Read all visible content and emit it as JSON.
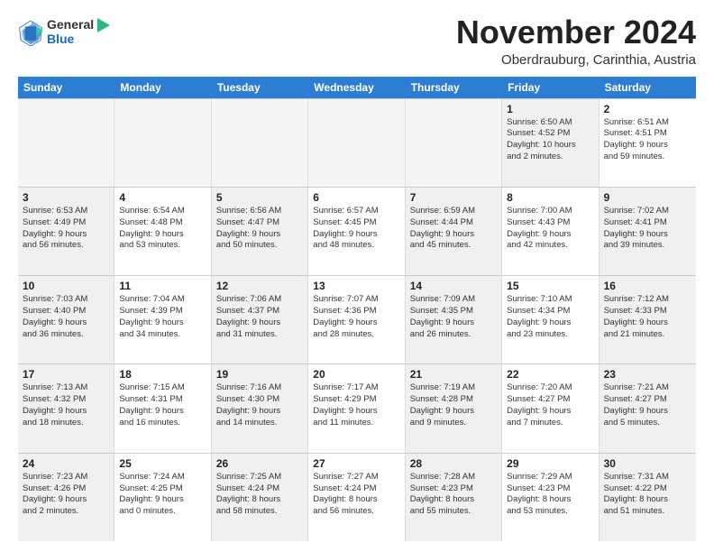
{
  "logo": {
    "general": "General",
    "blue": "Blue"
  },
  "header": {
    "month": "November 2024",
    "location": "Oberdrauburg, Carinthia, Austria"
  },
  "weekdays": [
    "Sunday",
    "Monday",
    "Tuesday",
    "Wednesday",
    "Thursday",
    "Friday",
    "Saturday"
  ],
  "weeks": [
    [
      {
        "day": "",
        "text": "",
        "empty": true
      },
      {
        "day": "",
        "text": "",
        "empty": true
      },
      {
        "day": "",
        "text": "",
        "empty": true
      },
      {
        "day": "",
        "text": "",
        "empty": true
      },
      {
        "day": "",
        "text": "",
        "empty": true
      },
      {
        "day": "1",
        "text": "Sunrise: 6:50 AM\nSunset: 4:52 PM\nDaylight: 10 hours\nand 2 minutes.",
        "shaded": true
      },
      {
        "day": "2",
        "text": "Sunrise: 6:51 AM\nSunset: 4:51 PM\nDaylight: 9 hours\nand 59 minutes.",
        "shaded": false
      }
    ],
    [
      {
        "day": "3",
        "text": "Sunrise: 6:53 AM\nSunset: 4:49 PM\nDaylight: 9 hours\nand 56 minutes.",
        "shaded": true
      },
      {
        "day": "4",
        "text": "Sunrise: 6:54 AM\nSunset: 4:48 PM\nDaylight: 9 hours\nand 53 minutes.",
        "shaded": false
      },
      {
        "day": "5",
        "text": "Sunrise: 6:56 AM\nSunset: 4:47 PM\nDaylight: 9 hours\nand 50 minutes.",
        "shaded": true
      },
      {
        "day": "6",
        "text": "Sunrise: 6:57 AM\nSunset: 4:45 PM\nDaylight: 9 hours\nand 48 minutes.",
        "shaded": false
      },
      {
        "day": "7",
        "text": "Sunrise: 6:59 AM\nSunset: 4:44 PM\nDaylight: 9 hours\nand 45 minutes.",
        "shaded": true
      },
      {
        "day": "8",
        "text": "Sunrise: 7:00 AM\nSunset: 4:43 PM\nDaylight: 9 hours\nand 42 minutes.",
        "shaded": false
      },
      {
        "day": "9",
        "text": "Sunrise: 7:02 AM\nSunset: 4:41 PM\nDaylight: 9 hours\nand 39 minutes.",
        "shaded": true
      }
    ],
    [
      {
        "day": "10",
        "text": "Sunrise: 7:03 AM\nSunset: 4:40 PM\nDaylight: 9 hours\nand 36 minutes.",
        "shaded": true
      },
      {
        "day": "11",
        "text": "Sunrise: 7:04 AM\nSunset: 4:39 PM\nDaylight: 9 hours\nand 34 minutes.",
        "shaded": false
      },
      {
        "day": "12",
        "text": "Sunrise: 7:06 AM\nSunset: 4:37 PM\nDaylight: 9 hours\nand 31 minutes.",
        "shaded": true
      },
      {
        "day": "13",
        "text": "Sunrise: 7:07 AM\nSunset: 4:36 PM\nDaylight: 9 hours\nand 28 minutes.",
        "shaded": false
      },
      {
        "day": "14",
        "text": "Sunrise: 7:09 AM\nSunset: 4:35 PM\nDaylight: 9 hours\nand 26 minutes.",
        "shaded": true
      },
      {
        "day": "15",
        "text": "Sunrise: 7:10 AM\nSunset: 4:34 PM\nDaylight: 9 hours\nand 23 minutes.",
        "shaded": false
      },
      {
        "day": "16",
        "text": "Sunrise: 7:12 AM\nSunset: 4:33 PM\nDaylight: 9 hours\nand 21 minutes.",
        "shaded": true
      }
    ],
    [
      {
        "day": "17",
        "text": "Sunrise: 7:13 AM\nSunset: 4:32 PM\nDaylight: 9 hours\nand 18 minutes.",
        "shaded": true
      },
      {
        "day": "18",
        "text": "Sunrise: 7:15 AM\nSunset: 4:31 PM\nDaylight: 9 hours\nand 16 minutes.",
        "shaded": false
      },
      {
        "day": "19",
        "text": "Sunrise: 7:16 AM\nSunset: 4:30 PM\nDaylight: 9 hours\nand 14 minutes.",
        "shaded": true
      },
      {
        "day": "20",
        "text": "Sunrise: 7:17 AM\nSunset: 4:29 PM\nDaylight: 9 hours\nand 11 minutes.",
        "shaded": false
      },
      {
        "day": "21",
        "text": "Sunrise: 7:19 AM\nSunset: 4:28 PM\nDaylight: 9 hours\nand 9 minutes.",
        "shaded": true
      },
      {
        "day": "22",
        "text": "Sunrise: 7:20 AM\nSunset: 4:27 PM\nDaylight: 9 hours\nand 7 minutes.",
        "shaded": false
      },
      {
        "day": "23",
        "text": "Sunrise: 7:21 AM\nSunset: 4:27 PM\nDaylight: 9 hours\nand 5 minutes.",
        "shaded": true
      }
    ],
    [
      {
        "day": "24",
        "text": "Sunrise: 7:23 AM\nSunset: 4:26 PM\nDaylight: 9 hours\nand 2 minutes.",
        "shaded": true
      },
      {
        "day": "25",
        "text": "Sunrise: 7:24 AM\nSunset: 4:25 PM\nDaylight: 9 hours\nand 0 minutes.",
        "shaded": false
      },
      {
        "day": "26",
        "text": "Sunrise: 7:25 AM\nSunset: 4:24 PM\nDaylight: 8 hours\nand 58 minutes.",
        "shaded": true
      },
      {
        "day": "27",
        "text": "Sunrise: 7:27 AM\nSunset: 4:24 PM\nDaylight: 8 hours\nand 56 minutes.",
        "shaded": false
      },
      {
        "day": "28",
        "text": "Sunrise: 7:28 AM\nSunset: 4:23 PM\nDaylight: 8 hours\nand 55 minutes.",
        "shaded": true
      },
      {
        "day": "29",
        "text": "Sunrise: 7:29 AM\nSunset: 4:23 PM\nDaylight: 8 hours\nand 53 minutes.",
        "shaded": false
      },
      {
        "day": "30",
        "text": "Sunrise: 7:31 AM\nSunset: 4:22 PM\nDaylight: 8 hours\nand 51 minutes.",
        "shaded": true
      }
    ]
  ]
}
